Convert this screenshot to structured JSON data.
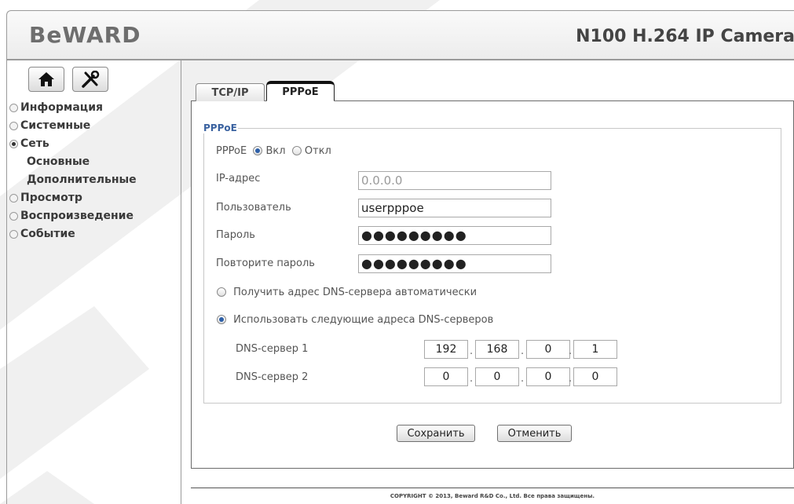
{
  "header": {
    "logo": "BeWARD",
    "title": "N100 H.264 IP Camera"
  },
  "toolbar": {
    "home_icon": "home-icon",
    "settings_icon": "tools-icon"
  },
  "sidebar": {
    "items": [
      {
        "label": "Информация",
        "selected": false
      },
      {
        "label": "Системные",
        "selected": false
      },
      {
        "label": "Сеть",
        "selected": true
      },
      {
        "label": "Основные",
        "sub": true
      },
      {
        "label": "Дополнительные",
        "sub": true
      },
      {
        "label": "Просмотр",
        "selected": false
      },
      {
        "label": "Воспроизведение",
        "selected": false
      },
      {
        "label": "Событие",
        "selected": false
      }
    ]
  },
  "tabs": [
    {
      "label": "TCP/IP"
    },
    {
      "label": "PPPoE",
      "active": true
    }
  ],
  "form": {
    "legend": "PPPoE",
    "pppoe_label": "PPPoE",
    "on_label": "Вкл",
    "off_label": "Откл",
    "pppoe_state": "on",
    "ip_label": "IP-адрес",
    "ip_value": "0.0.0.0",
    "user_label": "Пользователь",
    "user_value": "userpppoe",
    "password_label": "Пароль",
    "password_value": "●●●●●●●●●",
    "repeat_password_label": "Повторите пароль",
    "repeat_password_value": "●●●●●●●●●",
    "dns_auto_label": "Получить адрес DNS-сервера автоматически",
    "dns_manual_label": "Использовать следующие адреса DNS-серверов",
    "dns_mode": "manual",
    "dns1_label": "DNS-сервер 1",
    "dns1": [
      "192",
      "168",
      "0",
      "1"
    ],
    "dns2_label": "DNS-сервер 2",
    "dns2": [
      "0",
      "0",
      "0",
      "0"
    ],
    "save_label": "Сохранить",
    "cancel_label": "Отменить"
  },
  "footer": {
    "copyright": "COPYRIGHT © 2013, Beward R&D Co., Ltd. Все права защищены."
  },
  "colors": {
    "accent": "#3a62a0",
    "border": "#9a9a9a",
    "watermark": "#f1f1f1"
  }
}
